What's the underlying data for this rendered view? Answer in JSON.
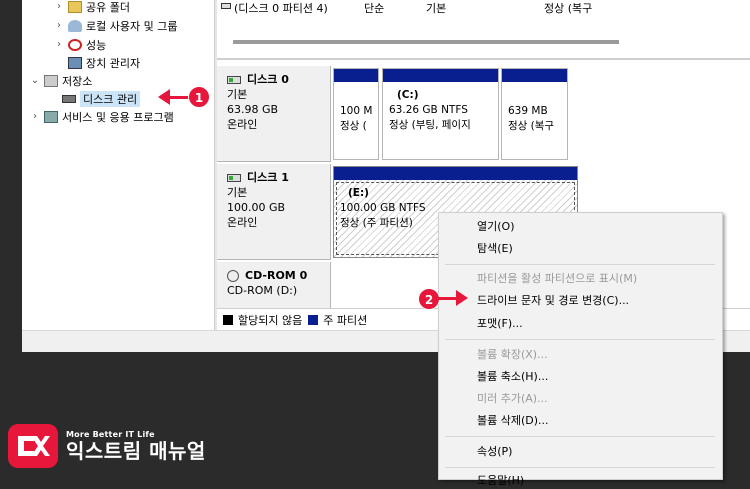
{
  "volume_list": {
    "row": {
      "volume": "(디스크 0 파티션 4)",
      "layout": "단순",
      "type": "기본",
      "status": "정상 (복구"
    }
  },
  "tree": {
    "items": [
      {
        "label": "공유 폴더",
        "icon": "shared-folder-icon"
      },
      {
        "label": "로컬 사용자 및 그룹",
        "icon": "users-icon"
      },
      {
        "label": "성능",
        "icon": "performance-icon"
      },
      {
        "label": "장치 관리자",
        "icon": "device-manager-icon"
      },
      {
        "label": "저장소",
        "icon": "storage-icon"
      },
      {
        "label": "디스크 관리",
        "icon": "disk-management-icon"
      },
      {
        "label": "서비스 및 응용 프로그램",
        "icon": "services-icon"
      }
    ]
  },
  "disks": [
    {
      "name": "디스크 0",
      "type": "기본",
      "size": "63.98 GB",
      "status": "온라인",
      "partitions": [
        {
          "name": "",
          "line1": "100 M",
          "line2": "정상 ("
        },
        {
          "name": "(C:)",
          "line1": "63.26 GB NTFS",
          "line2": "정상 (부팅, 페이지"
        },
        {
          "name": "",
          "line1": "639 MB",
          "line2": "정상 (복구"
        }
      ]
    },
    {
      "name": "디스크 1",
      "type": "기본",
      "size": "100.00 GB",
      "status": "온라인",
      "partitions": [
        {
          "name": "(E:)",
          "line1": "100.00 GB NTFS",
          "line2": "정상 (주 파티션)"
        }
      ]
    },
    {
      "name": "CD-ROM 0",
      "type": "CD-ROM (D:)"
    }
  ],
  "legend": {
    "unallocated": "할당되지 않음",
    "primary": "주 파티션"
  },
  "context_menu": {
    "items": [
      {
        "label": "열기(O)",
        "enabled": true
      },
      {
        "label": "탐색(E)",
        "enabled": true
      },
      {
        "label": "파티션을 활성 파티션으로 표시(M)",
        "enabled": false
      },
      {
        "label": "드라이브 문자 및 경로 변경(C)...",
        "enabled": true
      },
      {
        "label": "포맷(F)...",
        "enabled": true
      },
      {
        "label": "볼륨 확장(X)...",
        "enabled": false
      },
      {
        "label": "볼륨 축소(H)...",
        "enabled": true
      },
      {
        "label": "미러 추가(A)...",
        "enabled": false
      },
      {
        "label": "볼륨 삭제(D)...",
        "enabled": true
      },
      {
        "label": "속성(P)",
        "enabled": true
      },
      {
        "label": "도움말(H)",
        "enabled": true
      }
    ]
  },
  "callouts": {
    "one": "1",
    "two": "2"
  },
  "logo": {
    "subtitle": "More Better IT Life",
    "title": "익스트림 매뉴얼"
  },
  "colors": {
    "accent": "#e6173b",
    "partition_bar": "#0a1f8f",
    "menu_bg": "#f2f2f2"
  }
}
